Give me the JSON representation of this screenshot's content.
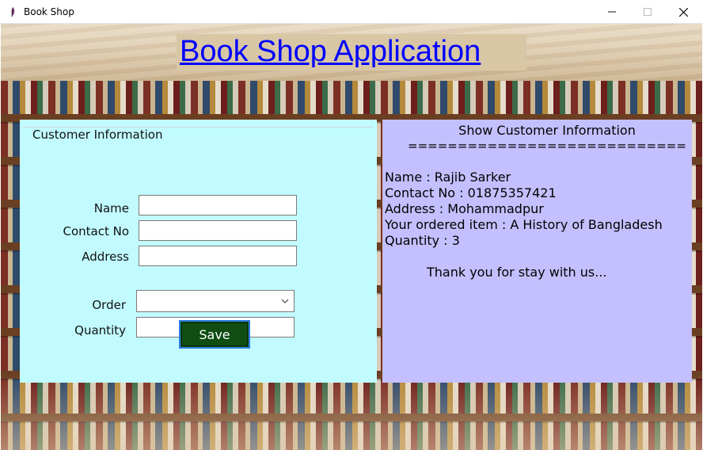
{
  "window": {
    "title": "Book Shop",
    "icon": "feather-icon"
  },
  "header": {
    "title": "Book Shop Application"
  },
  "customer_form": {
    "group_label": "Customer Information",
    "labels": {
      "name": "Name",
      "contact": "Contact No",
      "address": "Address",
      "order": "Order",
      "quantity": "Quantity"
    },
    "values": {
      "name": "",
      "contact": "",
      "address": "",
      "order": "",
      "quantity": ""
    },
    "save_label": "Save"
  },
  "info_panel": {
    "title": "Show Customer Information",
    "separator": "============================",
    "lines": [
      "Name : Rajib Sarker",
      "Contact No : 01875357421",
      "Address : Mohammadpur",
      "Your ordered item : A History of Bangladesh",
      "Quantity : 3"
    ],
    "thanks": "Thank you for stay with us..."
  },
  "colors": {
    "form_panel_bg": "#c2fbff",
    "info_panel_bg": "#c4c0ff",
    "save_button_bg": "#0f4d12",
    "title_text": "#0000ff"
  }
}
